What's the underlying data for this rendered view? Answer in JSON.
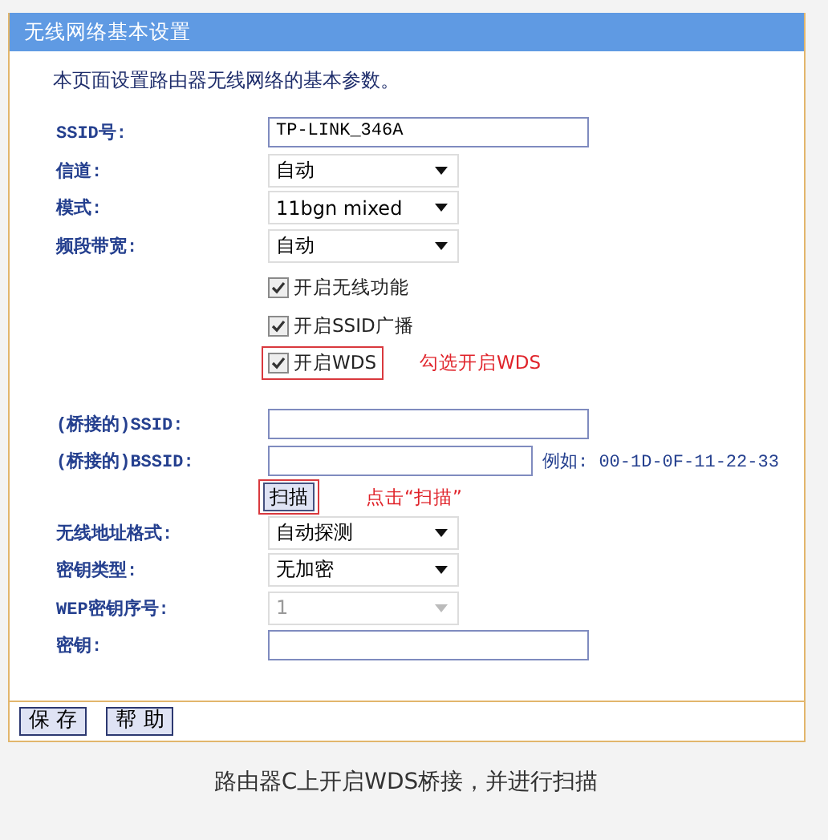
{
  "panel": {
    "title": "无线网络基本设置",
    "intro": "本页面设置路由器无线网络的基本参数。"
  },
  "rows": [
    {
      "kind": "text",
      "label": "SSID号:",
      "value": "TP-LINK_346A"
    },
    {
      "kind": "select",
      "label": "信道:",
      "value": "自动",
      "disabled": false
    },
    {
      "kind": "select",
      "label": "模式:",
      "value": "11bgn mixed",
      "disabled": false
    },
    {
      "kind": "select",
      "label": "频段带宽:",
      "value": "自动",
      "disabled": false
    },
    {
      "kind": "checkbox",
      "label": "开启无线功能",
      "checked": true,
      "highlighted": false
    },
    {
      "kind": "checkbox",
      "label": "开启SSID广播",
      "checked": true,
      "highlighted": false
    },
    {
      "kind": "checkbox",
      "label": "开启WDS",
      "checked": true,
      "highlighted": true,
      "note": "勾选开启WDS"
    },
    {
      "kind": "text",
      "label": "(桥接的)SSID:"
    },
    {
      "kind": "text",
      "label": "(桥接的)BSSID:",
      "hint": "例如: 00-1D-0F-11-22-33"
    },
    {
      "kind": "button",
      "label": "扫描",
      "highlighted": true,
      "note": "点击“扫描”"
    },
    {
      "kind": "select",
      "label": "无线地址格式:",
      "value": "自动探测",
      "disabled": false
    },
    {
      "kind": "select",
      "label": "密钥类型:",
      "value": "无加密",
      "disabled": false
    },
    {
      "kind": "select",
      "label": "WEP密钥序号:",
      "value": "1",
      "disabled": true
    },
    {
      "kind": "text",
      "label": "密钥:"
    }
  ],
  "buttons": [
    "保 存",
    "帮 助"
  ],
  "caption": "路由器C上开启WDS桥接，并进行扫描"
}
